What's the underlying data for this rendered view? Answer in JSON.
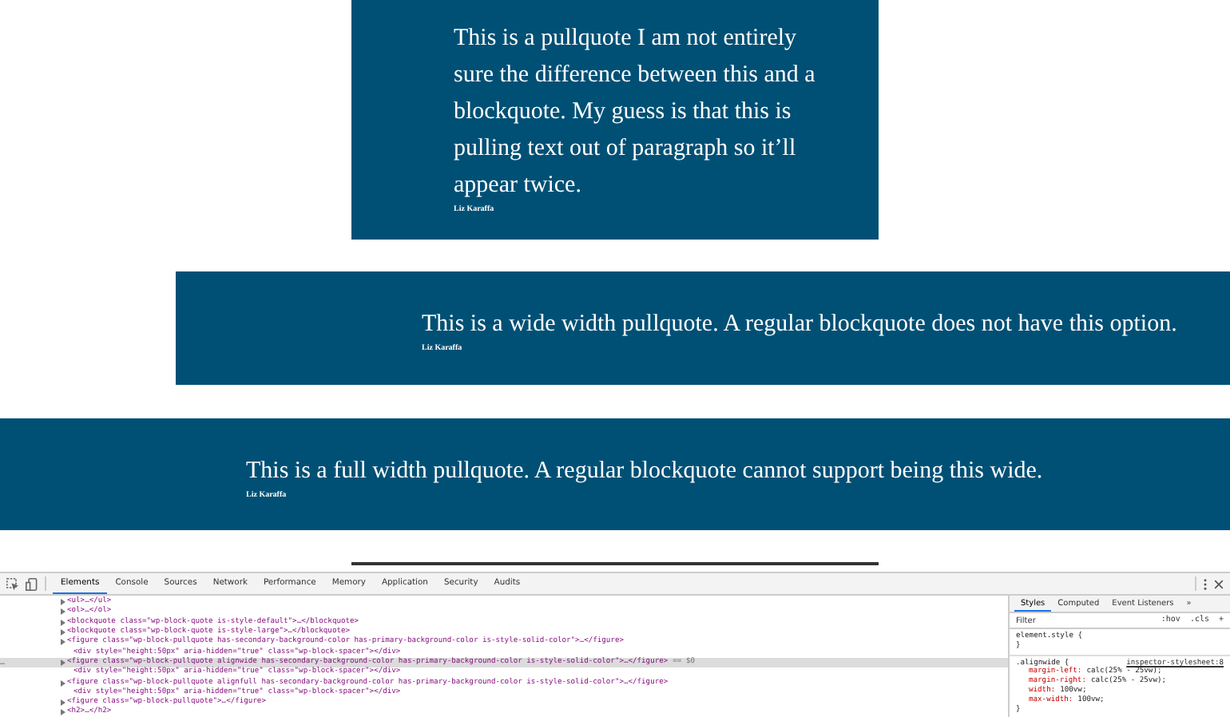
{
  "pullquotes": [
    {
      "kind": "regular",
      "text": "This is a pullquote I am not entirely sure the difference between this and a blockquote. My guess is that this is pulling text out of paragraph so it’ll appear twice.",
      "cite": "Liz Karaffa"
    },
    {
      "kind": "wide",
      "text": "This is a wide width pullquote. A regular blockquote does not have this option.",
      "cite": "Liz Karaffa"
    },
    {
      "kind": "full",
      "text": "This is a full width pullquote. A regular blockquote cannot support being this wide.",
      "cite": "Liz Karaffa"
    }
  ],
  "devtools": {
    "tabs": [
      {
        "label": "Elements",
        "selected": true
      },
      {
        "label": "Console",
        "selected": false
      },
      {
        "label": "Sources",
        "selected": false
      },
      {
        "label": "Network",
        "selected": false
      },
      {
        "label": "Performance",
        "selected": false
      },
      {
        "label": "Memory",
        "selected": false
      },
      {
        "label": "Application",
        "selected": false
      },
      {
        "label": "Security",
        "selected": false
      },
      {
        "label": "Audits",
        "selected": false
      }
    ],
    "dom_nodes": [
      {
        "text": "<ul>…</ul>",
        "expandable": true,
        "selected": false
      },
      {
        "text": "<ol>…</ol>",
        "expandable": true,
        "selected": false
      },
      {
        "text": "<blockquote class=\"wp-block-quote is-style-default\">…</blockquote>",
        "expandable": true,
        "selected": false
      },
      {
        "text": "<blockquote class=\"wp-block-quote is-style-large\">…</blockquote>",
        "expandable": true,
        "selected": false
      },
      {
        "text": "<figure class=\"wp-block-pullquote has-secondary-background-color has-primary-background-color is-style-solid-color\">…</figure>",
        "expandable": true,
        "selected": false
      },
      {
        "text": "<div style=\"height:50px\" aria-hidden=\"true\" class=\"wp-block-spacer\"></div>",
        "expandable": false,
        "selected": false
      },
      {
        "text": "<figure class=\"wp-block-pullquote alignwide has-secondary-background-color has-primary-background-color is-style-solid-color\">…</figure>",
        "expandable": true,
        "selected": true,
        "marker": "…",
        "note": "== $0"
      },
      {
        "text": "<div style=\"height:50px\" aria-hidden=\"true\" class=\"wp-block-spacer\"></div>",
        "expandable": false,
        "selected": false
      },
      {
        "text": "<figure class=\"wp-block-pullquote alignfull has-secondary-background-color has-primary-background-color is-style-solid-color\">…</figure>",
        "expandable": true,
        "selected": false
      },
      {
        "text": "<div style=\"height:50px\" aria-hidden=\"true\" class=\"wp-block-spacer\"></div>",
        "expandable": false,
        "selected": false
      },
      {
        "text": "<figure class=\"wp-block-pullquote\">…</figure>",
        "expandable": true,
        "selected": false
      },
      {
        "text": "<h2>…</h2>",
        "expandable": true,
        "selected": false
      }
    ],
    "styles_tabs": [
      {
        "label": "Styles",
        "selected": true
      },
      {
        "label": "Computed",
        "selected": false
      },
      {
        "label": "Event Listeners",
        "selected": false
      },
      {
        "label": "»",
        "selected": false
      }
    ],
    "filter": {
      "placeholder": "Filter"
    },
    "filter_buttons": [
      ":hov",
      ".cls",
      "+"
    ],
    "rules": [
      {
        "selector": "element.style {",
        "close": "}"
      },
      {
        "selector": ".alignwide {",
        "source": "inspector-stylesheet:8",
        "declarations": [
          {
            "property": "margin-left:",
            "value": "calc(25% - 25vw);"
          },
          {
            "property": "margin-right:",
            "value": "calc(25% - 25vw);"
          },
          {
            "property": "width:",
            "value": "100vw;"
          },
          {
            "property": "max-width:",
            "value": "100vw;"
          }
        ],
        "close": "}"
      }
    ]
  }
}
